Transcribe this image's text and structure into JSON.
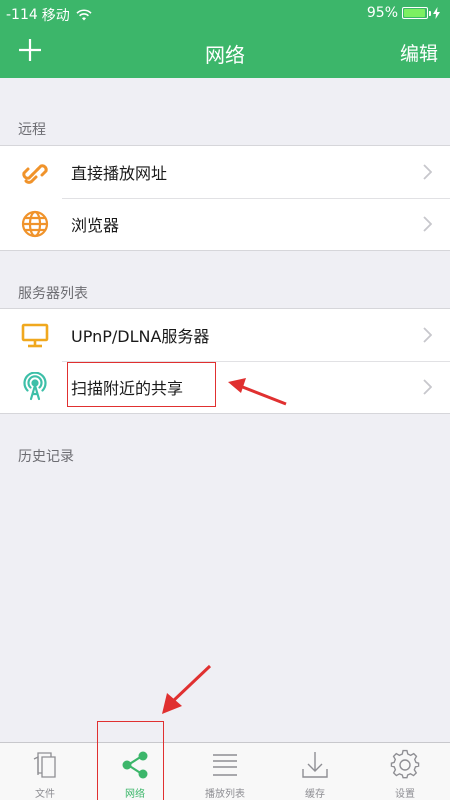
{
  "status_bar": {
    "signal": "-114",
    "carrier": "移动",
    "battery_percent": "95%",
    "battery_level": 0.95
  },
  "nav": {
    "add_label": "+",
    "title": "网络",
    "edit_label": "编辑"
  },
  "sections": {
    "remote": {
      "header": "远程",
      "items": [
        {
          "label": "直接播放网址",
          "icon": "link-icon"
        },
        {
          "label": "浏览器",
          "icon": "globe-icon"
        }
      ]
    },
    "servers": {
      "header": "服务器列表",
      "items": [
        {
          "label": "UPnP/DLNA服务器",
          "icon": "monitor-icon"
        },
        {
          "label": "扫描附近的共享",
          "icon": "antenna-icon"
        }
      ]
    },
    "history": {
      "header": "历史记录"
    }
  },
  "tabbar": {
    "tabs": [
      {
        "label": "文件",
        "icon": "files-icon",
        "active": false
      },
      {
        "label": "网络",
        "icon": "share-icon",
        "active": true
      },
      {
        "label": "播放列表",
        "icon": "playlist-icon",
        "active": false
      },
      {
        "label": "缓存",
        "icon": "download-icon",
        "active": false
      },
      {
        "label": "设置",
        "icon": "gear-icon",
        "active": false
      }
    ]
  },
  "colors": {
    "brand_green": "#3cb66a",
    "icon_orange": "#f0932b",
    "icon_teal": "#3dbfa8",
    "annotation_red": "#e03030"
  }
}
